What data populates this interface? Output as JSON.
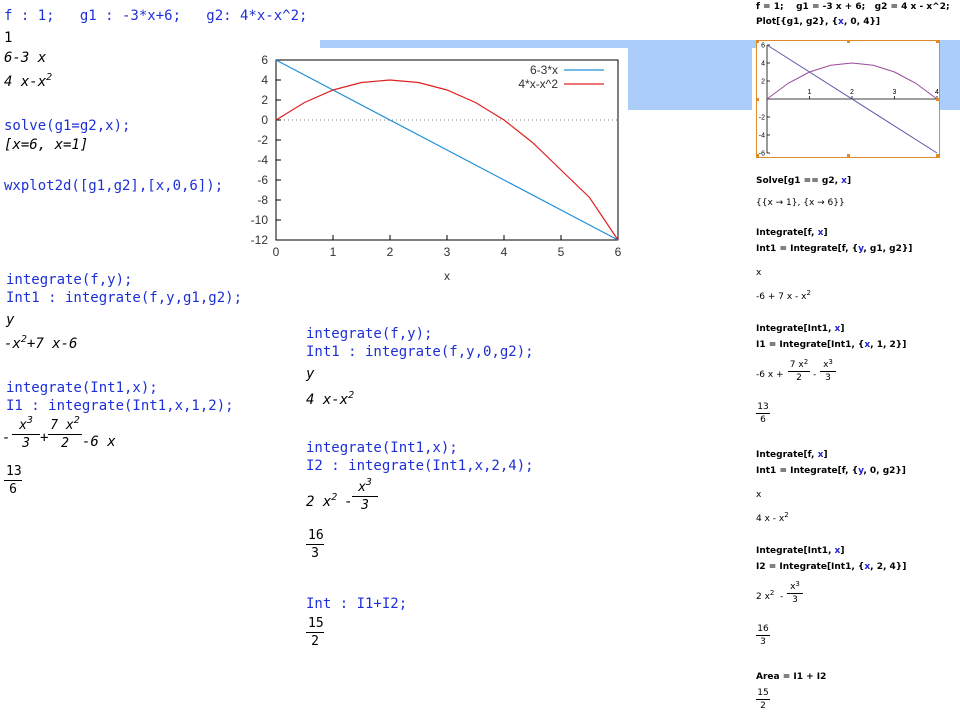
{
  "maxima_left": {
    "def_line": "f : 1;   g1 : -3*x+6;   g2: 4*x-x^2;",
    "out_1": "1",
    "out_2": "6-3 x",
    "out_3_base": "4 x-x",
    "out_3_exp": "2",
    "solve_cmd": "solve(g1=g2,x);",
    "solve_out": "[x=6, x=1]",
    "plot_cmd": "wxplot2d([g1,g2],[x,0,6]);",
    "int_cmd1": "integrate(f,y);",
    "int_cmd2": "Int1 : integrate(f,y,g1,g2);",
    "int_out1": "y",
    "int_out2_a": "-x",
    "int_out2_exp": "2",
    "int_out2_b": "+7 x-6",
    "int_cmd3": "integrate(Int1,x);",
    "int_cmd4": "I1 : integrate(Int1,x,1,2);",
    "i1_expr_num1": "x",
    "i1_expr_num1_exp": "3",
    "i1_expr_den1": "3",
    "i1_expr_num2": "7 x",
    "i1_expr_num2_exp": "2",
    "i1_expr_den2": "2",
    "i1_expr_minus": "-",
    "i1_expr_plus": "+",
    "i1_expr_tail": "-6 x",
    "i1_num": "13",
    "i1_den": "6"
  },
  "maxima_mid": {
    "cmd1": "integrate(f,y);",
    "cmd2": "Int1 : integrate(f,y,0,g2);",
    "out1": "y",
    "out2_a": "4 x-x",
    "out2_exp": "2",
    "cmd3": "integrate(Int1,x);",
    "cmd4": "I2 : integrate(Int1,x,2,4);",
    "out3_a": "2 x",
    "out3_exp": "2",
    "out3_minus": "-",
    "out3_num": "x",
    "out3_num_exp": "3",
    "out3_den": "3",
    "i2_num": "16",
    "i2_den": "3",
    "cmd5": "Int : I1+I2;",
    "int_num": "15",
    "int_den": "2"
  },
  "chart_data": [
    {
      "type": "line",
      "x_label": "x",
      "xlim": [
        0,
        6
      ],
      "ylim": [
        -12,
        6
      ],
      "x_ticks": [
        0,
        1,
        2,
        3,
        4,
        5,
        6
      ],
      "y_ticks": [
        6,
        4,
        2,
        0,
        -2,
        -4,
        -6,
        -8,
        -10,
        -12
      ],
      "legend_position": "top-right",
      "zero_line": "dotted",
      "series": [
        {
          "name": "6-3*x",
          "color": "#1f8fd8",
          "x": [
            0,
            6
          ],
          "y": [
            6,
            -12
          ]
        },
        {
          "name": "4*x-x^2",
          "color": "#e02020",
          "x": [
            0,
            0.5,
            1,
            1.5,
            2,
            2.5,
            3,
            3.5,
            4,
            4.5,
            5,
            5.5,
            6
          ],
          "y": [
            0,
            1.75,
            3,
            3.75,
            4,
            3.75,
            3,
            1.75,
            0,
            -2.25,
            -5,
            -7.75,
            -12
          ]
        }
      ]
    },
    {
      "type": "line",
      "xlim": [
        0,
        4
      ],
      "ylim": [
        -6,
        6
      ],
      "x_ticks": [
        1,
        2,
        3,
        4
      ],
      "y_ticks": [
        6,
        4,
        2,
        -2,
        -4,
        -6
      ],
      "series": [
        {
          "name": "",
          "color": "#5a5aa8",
          "x": [
            0,
            4
          ],
          "y": [
            6,
            -6
          ]
        },
        {
          "name": "",
          "color": "#9a4a9a",
          "x": [
            0,
            0.5,
            1,
            1.5,
            2,
            2.5,
            3,
            3.5,
            4
          ],
          "y": [
            0,
            1.75,
            3,
            3.75,
            4,
            3.75,
            3,
            1.75,
            0
          ]
        }
      ]
    }
  ],
  "mathematica": {
    "l1": "f = 1;    g1 = -3 x + 6;   g2 = 4 x - x^2;",
    "l2_pre": "Plot[{g1, g2}, {",
    "l2_x": "x",
    "l2_post": ", 0, 4}]",
    "solve_pre": "Solve[g1 == g2, ",
    "solve_x": "x",
    "solve_post": "]",
    "solve_out": "{{x → 1}, {x → 6}}",
    "int1_pre": "Integrate[f, ",
    "int1_x": "x",
    "int1_post": "]",
    "int1b_pre": "Int1 = Integrate[f, {",
    "int1b_y": "y",
    "int1b_post": ", g1, g2}]",
    "out_x1": "x",
    "out_poly1_a": "-6 + 7 x - x",
    "out_poly1_exp": "2",
    "int2_pre": "Integrate[Int1, ",
    "int2_x": "x",
    "int2_post": "]",
    "int2b_pre": "I1 = Integrate[Int1, {",
    "int2b_x": "x",
    "int2b_post": ", 1, 2}]",
    "i1_a": "-6 x +",
    "i1_f1_num": "7 x",
    "i1_f1_exp": "2",
    "i1_f1_den": "2",
    "i1_minus": "-",
    "i1_f2_num": "x",
    "i1_f2_exp": "3",
    "i1_f2_den": "3",
    "i1_num": "13",
    "i1_den": "6",
    "int3_pre": "Integrate[f, ",
    "int3_x": "x",
    "int3_post": "]",
    "int3b_pre": "Int1 = Integrate[f, {",
    "int3b_y": "y",
    "int3b_post": ", 0, g2}]",
    "out_x2": "x",
    "out_poly2_a": "4 x - x",
    "out_poly2_exp": "2",
    "int4_pre": "Integrate[Int1, ",
    "int4_x": "x",
    "int4_post": "]",
    "int4b_pre": "I2 = Integrate[Int1, {",
    "int4b_x": "x",
    "int4b_post": ", 2, 4}]",
    "i2_a": "2 x",
    "i2_a_exp": "2",
    "i2_minus": "-",
    "i2_f_num": "x",
    "i2_f_exp": "3",
    "i2_f_den": "3",
    "i2_num": "16",
    "i2_den": "3",
    "area_line": "Area = I1 + I2",
    "area_num": "15",
    "area_den": "2"
  }
}
